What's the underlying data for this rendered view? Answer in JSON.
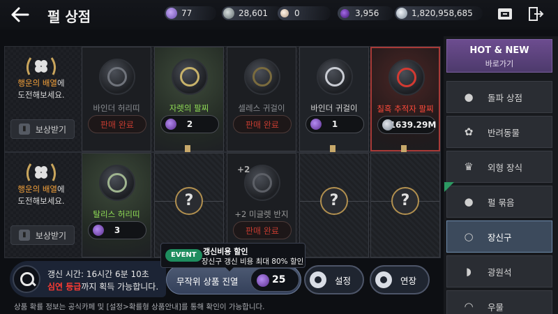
{
  "header": {
    "title": "펄 상점",
    "currencies": [
      {
        "icon": "mileage-coin-icon",
        "value": "77",
        "color": "#8c6ccf"
      },
      {
        "icon": "silver-coin-icon",
        "value": "28,601",
        "color": "#9aa6a8"
      },
      {
        "icon": "pearl-icon",
        "value": "0",
        "color": "#e9d9c8"
      },
      {
        "icon": "purple-pearl-icon",
        "value": "3,956",
        "color": "#6b2fb3"
      },
      {
        "icon": "silver-icon",
        "value": "1,820,958,685",
        "color": "#c9d3de"
      }
    ]
  },
  "rows": [
    {
      "luck_text_hl": "행운의 배열",
      "luck_text_rest": "에",
      "luck_text_line2": "도전해보세요.",
      "reward_label": "보상받기",
      "items": [
        {
          "name": "바인더 허리띠",
          "price": "판매 완료",
          "state": "sold"
        },
        {
          "name": "자렛의 팔찌",
          "price": "2",
          "state": "pearl"
        },
        {
          "name": "셀레스 귀걸이",
          "price": "판매 완료",
          "state": "sold"
        },
        {
          "name": "바인더 귀걸이",
          "price": "1",
          "state": "pearl"
        },
        {
          "name": "칠흑 추적자 팔찌",
          "price": "1639.29M",
          "state": "silver"
        }
      ]
    },
    {
      "luck_text_hl": "행운의 배열",
      "luck_text_rest": "에",
      "luck_text_line2": "도전해보세요.",
      "reward_label": "보상받기",
      "items": [
        {
          "name": "탈리스 허리띠",
          "price": "3",
          "state": "pearl"
        },
        {
          "name": "?",
          "state": "unknown"
        },
        {
          "name": "+2 미글렛 반지",
          "price": "판매 완료",
          "state": "sold",
          "badge": "+2"
        },
        {
          "name": "?",
          "state": "unknown"
        },
        {
          "name": "?",
          "state": "unknown"
        }
      ]
    }
  ],
  "sidebar": {
    "hot_title": "HOT & NEW",
    "hot_sub": "바로가기",
    "items": [
      {
        "label": "돌파 상점",
        "icon": "breakthrough-icon"
      },
      {
        "label": "반려동물",
        "icon": "paw-icon"
      },
      {
        "label": "외형 장식",
        "icon": "crown-icon"
      },
      {
        "label": "펄 묶음",
        "icon": "pearl-bundle-icon",
        "tag": "EVENT"
      },
      {
        "label": "장신구",
        "icon": "ring-icon",
        "active": true
      },
      {
        "label": "광원석",
        "icon": "crystal-icon"
      },
      {
        "label": "우물",
        "icon": "well-icon"
      }
    ]
  },
  "bottom": {
    "refresh_time": "갱신 시간: 16시간 6분 10초",
    "grade_hl": "심연 등급",
    "grade_rest": "까지 획득 가능합니다.",
    "random_label": "무작위 상품 진열",
    "random_price": "25",
    "settings_label": "설정",
    "extend_label": "연장",
    "event_badge": "EVENT",
    "event_title": "갱신비용 할인",
    "event_desc": "장신구 갱신 비용 최대 80% 할인",
    "footnote": "상품 확률 정보는 공식카페 및 [설정>확률형 상품안내]를 통해 확인이 가능합니다."
  }
}
